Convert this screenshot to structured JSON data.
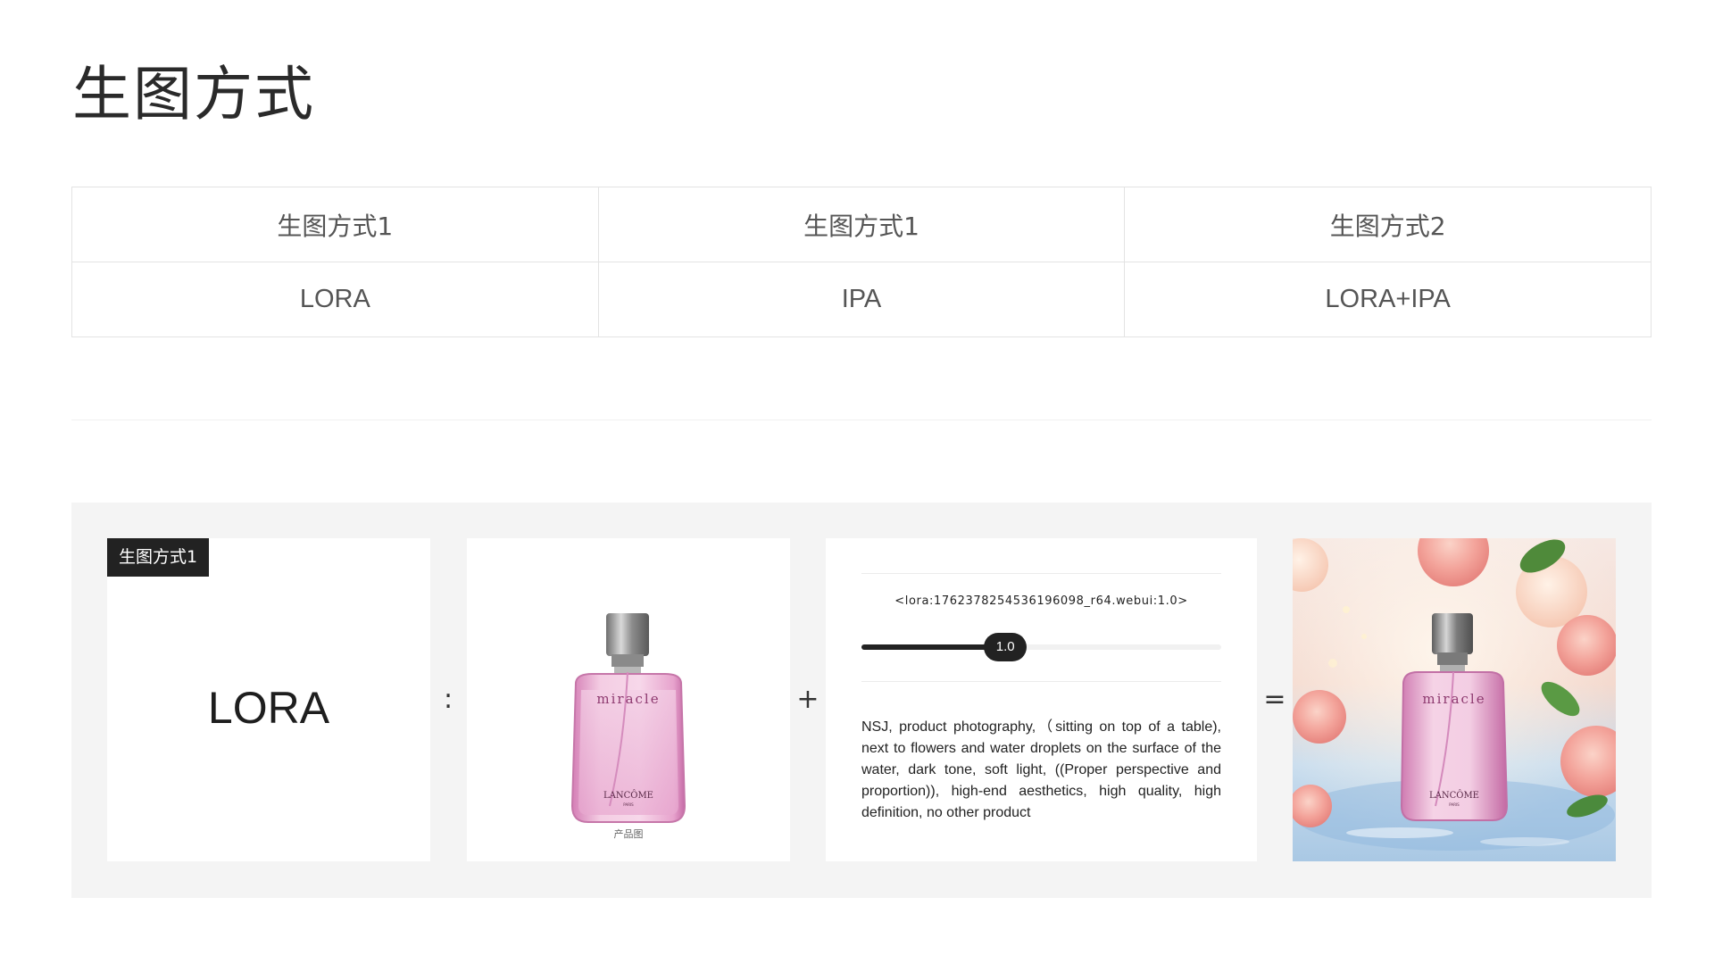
{
  "page": {
    "title": "生图方式"
  },
  "methods_table": {
    "headers": [
      "生图方式1",
      "生图方式1",
      "生图方式2"
    ],
    "values": [
      "LORA",
      "IPA",
      "LORA+IPA"
    ]
  },
  "example": {
    "tag": "生图方式1",
    "method_label": "LORA",
    "operators": {
      "colon": ":",
      "plus": "+",
      "equals": "="
    },
    "product": {
      "caption": "产品图",
      "brand": "LANCÔME",
      "brand_sub": "PARIS",
      "name": "miracle"
    },
    "prompt": {
      "lora_tag": "<lora:1762378254536196098_r64.webui:1.0>",
      "weight_label": "1.0",
      "weight_value": 1.0,
      "weight_max": 2.5,
      "text": "NSJ, product photography,（sitting on top of a table), next to flowers and water droplets on the surface of the water,  dark tone, soft light, ((Proper perspective and proportion)), high-end aesthetics, high quality, high definition,  no other product"
    },
    "result": {
      "brand": "LANCÔME",
      "brand_sub": "PARIS",
      "name": "miracle"
    }
  },
  "colors": {
    "panel_bg": "#f4f4f4",
    "tag_bg": "#222222",
    "bottle_pink": "#f2c4de",
    "cap_silver": "#9a9a9a"
  }
}
